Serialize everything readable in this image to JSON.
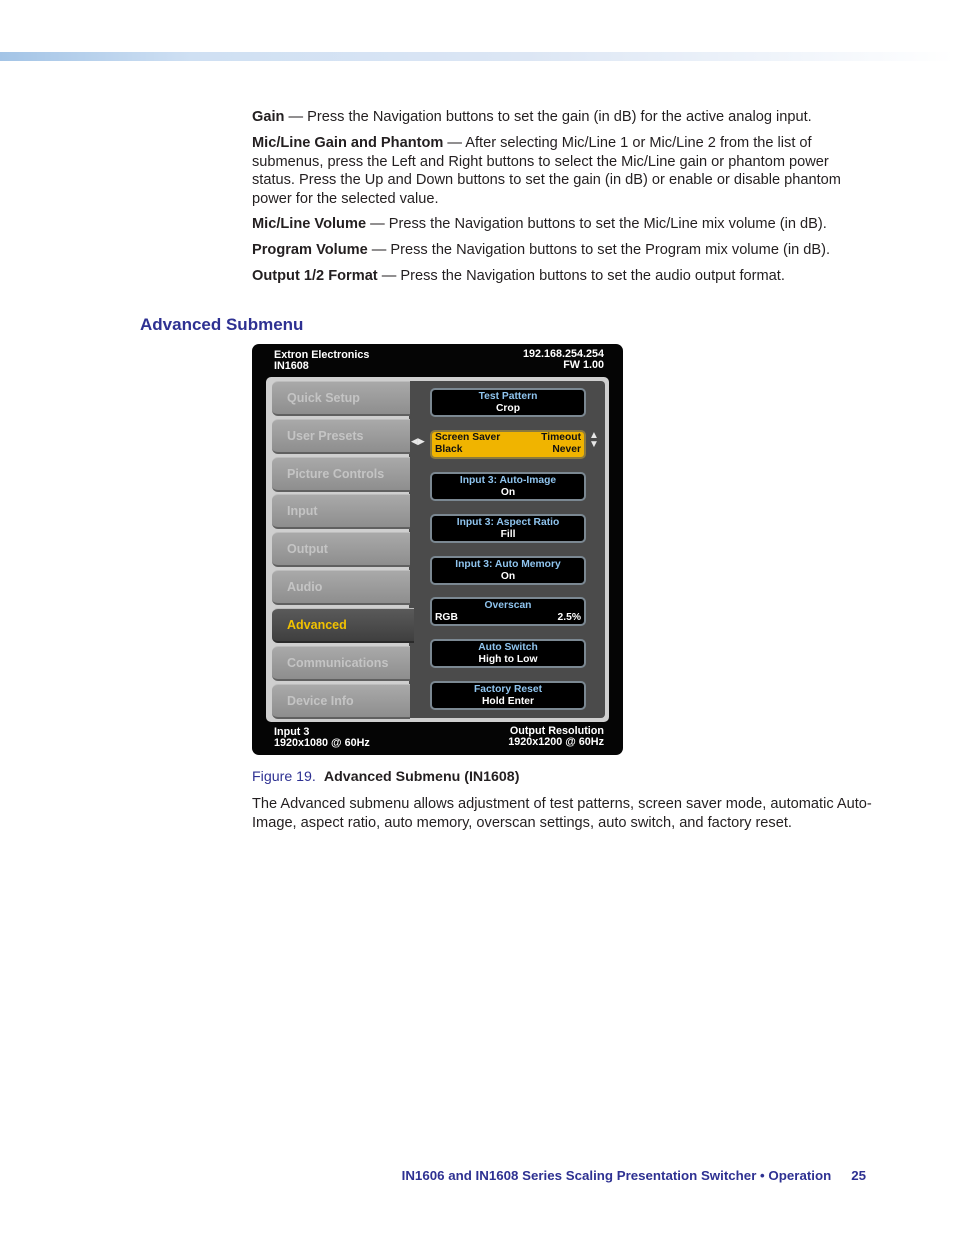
{
  "paragraphs": [
    {
      "term": "Gain",
      "text": " — Press the Navigation buttons to set the gain (in dB) for the active analog input."
    },
    {
      "term": "Mic/Line Gain and Phantom",
      "text": " — After selecting Mic/Line 1 or Mic/Line 2 from the list of submenus, press the Left and Right buttons to select the Mic/Line gain or phantom power status. Press the Up and Down buttons to set the gain (in dB) or enable or disable phantom power for the selected value."
    },
    {
      "term": "Mic/Line Volume",
      "text": " — Press the Navigation buttons to set the Mic/Line mix volume (in dB)."
    },
    {
      "term": "Program Volume",
      "text": " — Press the Navigation buttons to set the Program mix volume (in dB)."
    },
    {
      "term": "Output 1/2 Format",
      "text": " — Press the Navigation buttons to set the audio output format."
    }
  ],
  "section_heading": "Advanced Submenu",
  "osd": {
    "company": "Extron Electronics",
    "model": "IN1608",
    "ip": "192.168.254.254",
    "firmware": "FW 1.00",
    "menu_items": [
      {
        "label": "Quick Setup"
      },
      {
        "label": "User Presets"
      },
      {
        "label": "Picture Controls"
      },
      {
        "label": "Input"
      },
      {
        "label": "Output"
      },
      {
        "label": "Audio"
      },
      {
        "label": "Advanced",
        "active": true
      },
      {
        "label": "Communications"
      },
      {
        "label": "Device Info"
      }
    ],
    "options": [
      {
        "title": "Test Pattern",
        "value": "Crop"
      },
      {
        "left_title": "Screen Saver",
        "right_title": "Timeout",
        "left_value": "Black",
        "right_value": "Never",
        "selected": true
      },
      {
        "title": "Input 3: Auto-Image",
        "value": "On"
      },
      {
        "title": "Input 3: Aspect Ratio",
        "value": "Fill"
      },
      {
        "title": "Input 3: Auto Memory",
        "value": "On"
      },
      {
        "title": "Overscan",
        "left_value": "RGB",
        "right_value": "2.5%"
      },
      {
        "title": "Auto Switch",
        "value": "High to Low"
      },
      {
        "title": "Factory Reset",
        "value": "Hold Enter"
      }
    ],
    "input_label": "Input 3",
    "input_resolution": "1920x1080 @ 60Hz",
    "output_label": "Output Resolution",
    "output_resolution": "1920x1200 @ 60Hz"
  },
  "figure": {
    "number": "Figure 19.",
    "title": "Advanced Submenu (IN1608)"
  },
  "description": "The Advanced submenu allows adjustment of test patterns, screen saver mode, automatic Auto-Image, aspect ratio, auto memory, overscan settings, auto switch, and factory reset.",
  "footer": {
    "text": "IN1606 and IN1608 Series Scaling Presentation Switcher • Operation",
    "page": "25"
  }
}
